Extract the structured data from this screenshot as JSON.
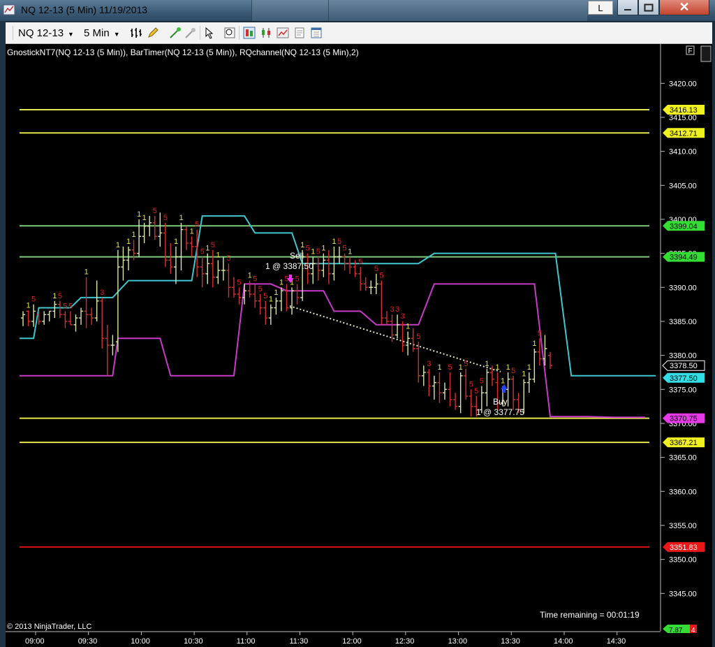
{
  "window": {
    "title": "NQ 12-13 (5 Min)  11/19/2013",
    "l_button": "L",
    "close_glyph": "✕"
  },
  "toolbar": {
    "instrument": "NQ 12-13",
    "period": "5 Min",
    "dropdown_glyph": "▼"
  },
  "chart": {
    "indicator_label": "GnostickNT7(NQ 12-13 (5 Min)), BarTimer(NQ 12-13 (5 Min)), RQchannel(NQ 12-13 (5 Min),2)",
    "f_button": "F",
    "copyright": "© 2013 NinjaTrader, LLC",
    "time_remaining": "Time remaining = 00:01:19",
    "bottom_badge_1": "7.87",
    "bottom_badge_2": "4",
    "sell_label": "Sell",
    "sell_detail": "1 @ 3387.50",
    "buy_label": "Buy",
    "buy_detail": "1 @ 3377.75",
    "colors": {
      "yellow": "#e6e64a",
      "green": "#7ccb7c",
      "red": "#e01010",
      "cyan": "#3fc7cf",
      "magenta": "#c83ac8",
      "bar_up": "#d8e8a8",
      "bar_down": "#d83030"
    }
  },
  "chart_data": {
    "type": "ohlc",
    "x_ticks": [
      "09:00",
      "09:30",
      "10:00",
      "10:30",
      "11:00",
      "11:30",
      "12:00",
      "12:30",
      "13:00",
      "13:30",
      "14:00",
      "14:30"
    ],
    "y_ticks": [
      "3420.00",
      "3415.00",
      "3410.00",
      "3405.00",
      "3400.00",
      "3395.00",
      "3390.00",
      "3385.00",
      "3380.00",
      "3375.00",
      "3370.00",
      "3365.00",
      "3360.00",
      "3355.00",
      "3350.00",
      "3345.00"
    ],
    "y_values": [
      3420,
      3415,
      3410,
      3405,
      3400,
      3395,
      3390,
      3385,
      3380,
      3375,
      3370,
      3365,
      3360,
      3355,
      3350,
      3345
    ],
    "ylim": [
      3343.3,
      3422.0
    ],
    "price_markers": [
      {
        "label": "3416.13",
        "value": 3416.13,
        "bg": "#f0f020",
        "fg": "#000"
      },
      {
        "label": "3412.71",
        "value": 3412.71,
        "bg": "#f0f020",
        "fg": "#000"
      },
      {
        "label": "3399.04",
        "value": 3399.04,
        "bg": "#33dd33",
        "fg": "#000"
      },
      {
        "label": "3394.49",
        "value": 3394.49,
        "bg": "#33dd33",
        "fg": "#000"
      },
      {
        "label": "3378.50",
        "value": 3378.5,
        "bg": "#000",
        "fg": "#fff"
      },
      {
        "label": "3377.50",
        "value": 3376.7,
        "bg": "#33dde6",
        "fg": "#000"
      },
      {
        "label": "3370.75",
        "value": 3370.75,
        "bg": "#e63ae6",
        "fg": "#000"
      },
      {
        "label": "3367.21",
        "value": 3367.21,
        "bg": "#f0f020",
        "fg": "#000"
      },
      {
        "label": "3351.83",
        "value": 3351.83,
        "bg": "#e81818",
        "fg": "#fff"
      }
    ],
    "horizontal_lines": [
      {
        "value": 3416.13,
        "color": "#e6e64a"
      },
      {
        "value": 3412.71,
        "color": "#e6e64a"
      },
      {
        "value": 3399.04,
        "color": "#7ccb7c"
      },
      {
        "value": 3394.49,
        "color": "#7ccb7c"
      },
      {
        "value": 3370.75,
        "color": "#e6e64a"
      },
      {
        "value": 3367.21,
        "color": "#e6e64a"
      },
      {
        "value": 3351.83,
        "color": "#e01010"
      }
    ],
    "bars": [
      {
        "o": 3385.5,
        "h": 3386.5,
        "l": 3384.3,
        "c": 3386.0,
        "lab": ""
      },
      {
        "o": 3386.5,
        "h": 3386.6,
        "l": 3384.3,
        "c": 3385.0,
        "lab": "1"
      },
      {
        "o": 3385.0,
        "h": 3387.5,
        "l": 3384.2,
        "c": 3386.5,
        "lab": "5"
      },
      {
        "o": 3386.0,
        "h": 3386.6,
        "l": 3384.5,
        "c": 3385.0,
        "lab": ""
      },
      {
        "o": 3385.0,
        "h": 3386.5,
        "l": 3384.5,
        "c": 3386.0,
        "lab": ""
      },
      {
        "o": 3386.0,
        "h": 3386.5,
        "l": 3385.0,
        "c": 3386.5,
        "lab": ""
      },
      {
        "o": 3386.5,
        "h": 3388.0,
        "l": 3385.5,
        "c": 3387.5,
        "lab": "1"
      },
      {
        "o": 3387.5,
        "h": 3388.0,
        "l": 3385.5,
        "c": 3386.0,
        "lab": "5"
      },
      {
        "o": 3386.0,
        "h": 3386.5,
        "l": 3384.0,
        "c": 3385.0,
        "lab": "5"
      },
      {
        "o": 3385.0,
        "h": 3386.5,
        "l": 3384.5,
        "c": 3384.5,
        "lab": "5"
      },
      {
        "o": 3384.5,
        "h": 3386.0,
        "l": 3383.5,
        "c": 3385.5,
        "lab": ""
      },
      {
        "o": 3385.5,
        "h": 3387.0,
        "l": 3384.5,
        "c": 3386.5,
        "lab": ""
      },
      {
        "o": 3386.5,
        "h": 3391.5,
        "l": 3384.0,
        "c": 3386.0,
        "lab": "1"
      },
      {
        "o": 3386.0,
        "h": 3387.0,
        "l": 3384.5,
        "c": 3385.5,
        "lab": ""
      },
      {
        "o": 3385.5,
        "h": 3391.0,
        "l": 3385.0,
        "c": 3388.0,
        "lab": ""
      },
      {
        "o": 3388.0,
        "h": 3388.5,
        "l": 3381.0,
        "c": 3382.5,
        "lab": "3"
      },
      {
        "o": 3382.5,
        "h": 3384.5,
        "l": 3377.0,
        "c": 3381.5,
        "lab": ""
      },
      {
        "o": 3381.5,
        "h": 3383.0,
        "l": 3380.0,
        "c": 3381.5,
        "lab": ""
      },
      {
        "o": 3382.0,
        "h": 3395.5,
        "l": 3380.5,
        "c": 3393.0,
        "lab": "1"
      },
      {
        "o": 3393.0,
        "h": 3396.0,
        "l": 3391.0,
        "c": 3394.0,
        "lab": ""
      },
      {
        "o": 3394.0,
        "h": 3396.0,
        "l": 3392.5,
        "c": 3395.5,
        "lab": "1"
      },
      {
        "o": 3395.5,
        "h": 3397.0,
        "l": 3394.0,
        "c": 3395.0,
        "lab": "1"
      },
      {
        "o": 3395.0,
        "h": 3400.0,
        "l": 3394.5,
        "c": 3397.5,
        "lab": "1"
      },
      {
        "o": 3397.5,
        "h": 3399.5,
        "l": 3396.5,
        "c": 3399.0,
        "lab": "1"
      },
      {
        "o": 3399.0,
        "h": 3400.5,
        "l": 3397.5,
        "c": 3399.5,
        "lab": ""
      },
      {
        "o": 3399.5,
        "h": 3400.5,
        "l": 3397.0,
        "c": 3397.5,
        "lab": "5"
      },
      {
        "o": 3397.5,
        "h": 3401.0,
        "l": 3396.0,
        "c": 3398.0,
        "lab": ""
      },
      {
        "o": 3398.0,
        "h": 3399.5,
        "l": 3393.0,
        "c": 3394.0,
        "lab": "5"
      },
      {
        "o": 3394.0,
        "h": 3396.5,
        "l": 3392.0,
        "c": 3393.0,
        "lab": ""
      },
      {
        "o": 3393.0,
        "h": 3396.0,
        "l": 3390.5,
        "c": 3394.5,
        "lab": "1"
      },
      {
        "o": 3394.5,
        "h": 3399.5,
        "l": 3392.5,
        "c": 3398.5,
        "lab": "1"
      },
      {
        "o": 3398.5,
        "h": 3399.0,
        "l": 3395.5,
        "c": 3396.5,
        "lab": ""
      },
      {
        "o": 3396.5,
        "h": 3397.5,
        "l": 3394.5,
        "c": 3396.0,
        "lab": "1"
      },
      {
        "o": 3396.0,
        "h": 3398.5,
        "l": 3391.5,
        "c": 3393.0,
        "lab": "5"
      },
      {
        "o": 3393.0,
        "h": 3394.5,
        "l": 3390.0,
        "c": 3392.0,
        "lab": "5"
      },
      {
        "o": 3392.0,
        "h": 3395.0,
        "l": 3390.5,
        "c": 3393.5,
        "lab": "1"
      },
      {
        "o": 3393.5,
        "h": 3395.5,
        "l": 3390.0,
        "c": 3391.5,
        "lab": "5"
      },
      {
        "o": 3391.5,
        "h": 3394.0,
        "l": 3390.5,
        "c": 3392.5,
        "lab": "1"
      },
      {
        "o": 3392.5,
        "h": 3394.5,
        "l": 3391.0,
        "c": 3392.5,
        "lab": ""
      },
      {
        "o": 3392.5,
        "h": 3393.5,
        "l": 3388.5,
        "c": 3390.0,
        "lab": "5"
      },
      {
        "o": 3390.0,
        "h": 3391.5,
        "l": 3388.5,
        "c": 3389.0,
        "lab": ""
      },
      {
        "o": 3389.0,
        "h": 3390.0,
        "l": 3387.5,
        "c": 3388.5,
        "lab": "5"
      },
      {
        "o": 3388.5,
        "h": 3390.5,
        "l": 3387.5,
        "c": 3389.5,
        "lab": ""
      },
      {
        "o": 3389.5,
        "h": 3391.0,
        "l": 3388.5,
        "c": 3389.0,
        "lab": "1"
      },
      {
        "o": 3389.0,
        "h": 3390.5,
        "l": 3387.0,
        "c": 3388.0,
        "lab": "5"
      },
      {
        "o": 3388.0,
        "h": 3389.0,
        "l": 3386.0,
        "c": 3387.0,
        "lab": "5"
      },
      {
        "o": 3387.0,
        "h": 3388.0,
        "l": 3384.5,
        "c": 3385.5,
        "lab": "5"
      },
      {
        "o": 3385.5,
        "h": 3387.5,
        "l": 3384.5,
        "c": 3387.0,
        "lab": "1"
      },
      {
        "o": 3387.0,
        "h": 3388.5,
        "l": 3386.0,
        "c": 3388.0,
        "lab": "1"
      },
      {
        "o": 3388.0,
        "h": 3390.0,
        "l": 3386.5,
        "c": 3389.5,
        "lab": "1"
      },
      {
        "o": 3389.5,
        "h": 3390.5,
        "l": 3386.5,
        "c": 3387.0,
        "lab": "5"
      },
      {
        "o": 3387.0,
        "h": 3390.0,
        "l": 3386.0,
        "c": 3389.5,
        "lab": "1"
      },
      {
        "o": 3389.5,
        "h": 3390.5,
        "l": 3387.5,
        "c": 3388.5,
        "lab": "5"
      },
      {
        "o": 3388.5,
        "h": 3395.5,
        "l": 3388.0,
        "c": 3394.5,
        "lab": "1"
      },
      {
        "o": 3394.5,
        "h": 3395.0,
        "l": 3390.5,
        "c": 3392.0,
        "lab": "5"
      },
      {
        "o": 3392.0,
        "h": 3394.5,
        "l": 3390.5,
        "c": 3393.5,
        "lab": "1"
      },
      {
        "o": 3393.5,
        "h": 3394.5,
        "l": 3391.0,
        "c": 3392.5,
        "lab": "5"
      },
      {
        "o": 3392.5,
        "h": 3395.0,
        "l": 3391.5,
        "c": 3394.0,
        "lab": "1"
      },
      {
        "o": 3394.0,
        "h": 3395.5,
        "l": 3390.5,
        "c": 3392.0,
        "lab": ""
      },
      {
        "o": 3392.0,
        "h": 3396.0,
        "l": 3391.0,
        "c": 3394.5,
        "lab": "1"
      },
      {
        "o": 3394.5,
        "h": 3396.0,
        "l": 3393.5,
        "c": 3394.5,
        "lab": "5"
      },
      {
        "o": 3394.5,
        "h": 3395.0,
        "l": 3392.5,
        "c": 3393.5,
        "lab": "5"
      },
      {
        "o": 3393.5,
        "h": 3394.5,
        "l": 3392.0,
        "c": 3393.0,
        "lab": "1"
      },
      {
        "o": 3393.0,
        "h": 3394.0,
        "l": 3391.5,
        "c": 3392.0,
        "lab": ""
      },
      {
        "o": 3392.0,
        "h": 3393.0,
        "l": 3389.5,
        "c": 3390.5,
        "lab": "5"
      },
      {
        "o": 3390.5,
        "h": 3391.5,
        "l": 3389.5,
        "c": 3390.0,
        "lab": ""
      },
      {
        "o": 3390.0,
        "h": 3391.0,
        "l": 3389.0,
        "c": 3390.0,
        "lab": ""
      },
      {
        "o": 3390.0,
        "h": 3392.0,
        "l": 3389.0,
        "c": 3390.5,
        "lab": "5"
      },
      {
        "o": 3390.5,
        "h": 3391.0,
        "l": 3384.5,
        "c": 3385.5,
        "lab": "5"
      },
      {
        "o": 3385.5,
        "h": 3386.5,
        "l": 3384.5,
        "c": 3385.0,
        "lab": ""
      },
      {
        "o": 3385.0,
        "h": 3386.0,
        "l": 3382.0,
        "c": 3383.0,
        "lab": "3"
      },
      {
        "o": 3383.0,
        "h": 3386.0,
        "l": 3382.5,
        "c": 3384.5,
        "lab": "3"
      },
      {
        "o": 3384.5,
        "h": 3385.0,
        "l": 3380.5,
        "c": 3381.5,
        "lab": "3"
      },
      {
        "o": 3381.5,
        "h": 3383.5,
        "l": 3380.0,
        "c": 3382.5,
        "lab": "1"
      },
      {
        "o": 3382.5,
        "h": 3384.0,
        "l": 3380.5,
        "c": 3381.0,
        "lab": ""
      },
      {
        "o": 3381.0,
        "h": 3382.0,
        "l": 3376.0,
        "c": 3377.0,
        "lab": "5"
      },
      {
        "o": 3377.0,
        "h": 3378.5,
        "l": 3375.5,
        "c": 3377.5,
        "lab": ""
      },
      {
        "o": 3377.5,
        "h": 3378.0,
        "l": 3374.0,
        "c": 3375.5,
        "lab": "3"
      },
      {
        "o": 3375.5,
        "h": 3377.0,
        "l": 3373.5,
        "c": 3376.0,
        "lab": ""
      },
      {
        "o": 3376.0,
        "h": 3377.5,
        "l": 3373.0,
        "c": 3374.5,
        "lab": "1"
      },
      {
        "o": 3374.5,
        "h": 3376.0,
        "l": 3373.5,
        "c": 3375.0,
        "lab": ""
      },
      {
        "o": 3375.0,
        "h": 3377.5,
        "l": 3372.5,
        "c": 3373.5,
        "lab": "5"
      },
      {
        "o": 3373.5,
        "h": 3374.5,
        "l": 3372.0,
        "c": 3372.5,
        "lab": ""
      },
      {
        "o": 3372.5,
        "h": 3377.5,
        "l": 3371.5,
        "c": 3377.0,
        "lab": "1"
      },
      {
        "o": 3377.0,
        "h": 3378.0,
        "l": 3373.5,
        "c": 3374.0,
        "lab": "5"
      },
      {
        "o": 3374.0,
        "h": 3375.0,
        "l": 3371.0,
        "c": 3372.5,
        "lab": "5"
      },
      {
        "o": 3372.5,
        "h": 3374.0,
        "l": 3371.0,
        "c": 3372.0,
        "lab": "5"
      },
      {
        "o": 3372.0,
        "h": 3375.5,
        "l": 3371.5,
        "c": 3374.5,
        "lab": "5"
      },
      {
        "o": 3374.5,
        "h": 3378.0,
        "l": 3372.5,
        "c": 3377.5,
        "lab": "1"
      },
      {
        "o": 3377.5,
        "h": 3378.5,
        "l": 3375.5,
        "c": 3376.5,
        "lab": ""
      },
      {
        "o": 3376.0,
        "h": 3377.5,
        "l": 3372.0,
        "c": 3373.0,
        "lab": "1"
      },
      {
        "o": 3373.0,
        "h": 3375.5,
        "l": 3372.5,
        "c": 3375.0,
        "lab": "1"
      },
      {
        "o": 3375.0,
        "h": 3377.5,
        "l": 3372.5,
        "c": 3376.5,
        "lab": "1"
      },
      {
        "o": 3376.5,
        "h": 3377.0,
        "l": 3372.0,
        "c": 3373.5,
        "lab": "5"
      },
      {
        "o": 3373.5,
        "h": 3374.5,
        "l": 3371.5,
        "c": 3372.0,
        "lab": ""
      },
      {
        "o": 3372.0,
        "h": 3376.5,
        "l": 3371.5,
        "c": 3376.0,
        "lab": "1"
      },
      {
        "o": 3376.0,
        "h": 3377.5,
        "l": 3374.5,
        "c": 3376.5,
        "lab": "1"
      },
      {
        "o": 3376.5,
        "h": 3381.0,
        "l": 3376.0,
        "c": 3380.5,
        "lab": "1"
      },
      {
        "o": 3380.5,
        "h": 3382.5,
        "l": 3378.5,
        "c": 3379.5,
        "lab": "5"
      },
      {
        "o": 3379.5,
        "h": 3383.0,
        "l": 3378.5,
        "c": 3381.0,
        "lab": ""
      },
      {
        "o": 3380.0,
        "h": 3380.5,
        "l": 3378.0,
        "c": 3378.5,
        "lab": ""
      }
    ],
    "cyan_line": [
      [
        0,
        3382.5
      ],
      [
        2,
        3382.5
      ],
      [
        3,
        3387.0
      ],
      [
        9,
        3387.0
      ],
      [
        11,
        3388.5
      ],
      [
        17,
        3388.5
      ],
      [
        20,
        3391.0
      ],
      [
        32,
        3391.0
      ],
      [
        34,
        3400.5
      ],
      [
        42,
        3400.5
      ],
      [
        44,
        3398.0
      ],
      [
        51,
        3398.0
      ],
      [
        53,
        3393.5
      ],
      [
        75,
        3393.5
      ],
      [
        78,
        3395.0
      ],
      [
        101,
        3395.0
      ],
      [
        104,
        3377.0
      ],
      [
        120,
        3377.0
      ]
    ],
    "magenta_line": [
      [
        0,
        3377.0
      ],
      [
        17,
        3377.0
      ],
      [
        18,
        3382.5
      ],
      [
        26,
        3382.5
      ],
      [
        28,
        3377.0
      ],
      [
        40,
        3377.0
      ],
      [
        42,
        3390.5
      ],
      [
        47,
        3390.5
      ],
      [
        50,
        3389.5
      ],
      [
        57,
        3389.5
      ],
      [
        59,
        3386.5
      ],
      [
        64,
        3386.5
      ],
      [
        67,
        3384.5
      ],
      [
        75,
        3384.5
      ],
      [
        78,
        3390.5
      ],
      [
        97,
        3390.5
      ],
      [
        100,
        3371.0
      ],
      [
        107,
        3371.0
      ],
      [
        112,
        3370.9
      ],
      [
        118,
        3370.9
      ]
    ],
    "trade_line": {
      "x1": 415,
      "y1": 438,
      "x2": 717,
      "y2": 532
    }
  }
}
